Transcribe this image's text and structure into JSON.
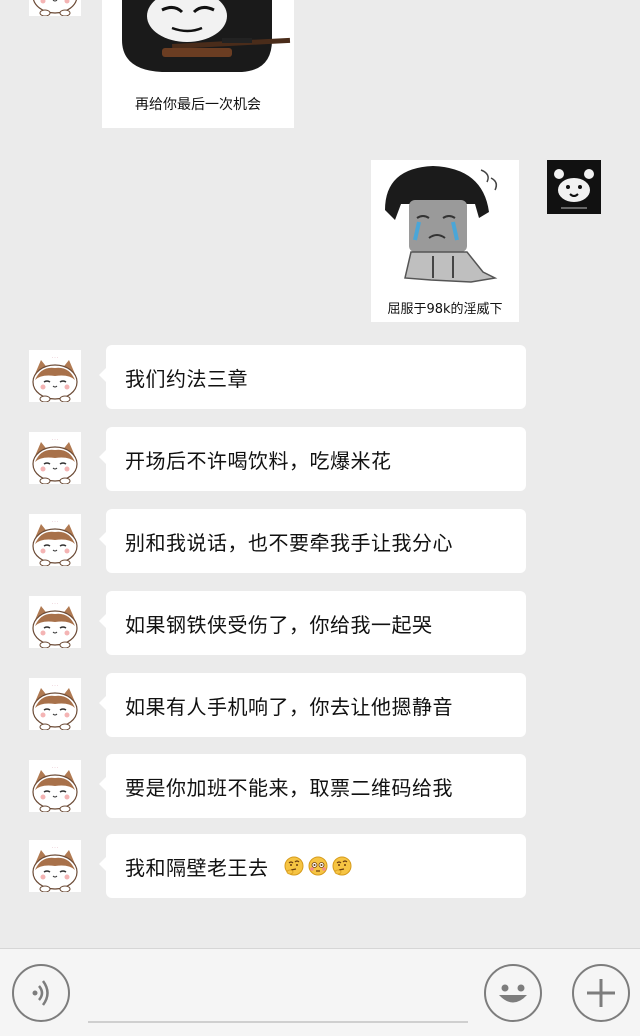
{
  "stickers": {
    "received_caption": "再给你最后一次机会",
    "sent_caption": "屈服于98k的淫威下"
  },
  "messages": [
    {
      "text": "我们约法三章"
    },
    {
      "text": "开场后不许喝饮料，吃爆米花"
    },
    {
      "text": "别和我说话，也不要牵我手让我分心"
    },
    {
      "text": "如果钢铁侠受伤了，你给我一起哭"
    },
    {
      "text": "如果有人手机响了，你去让他摁静音"
    },
    {
      "text": "要是你加班不能来，取票二维码给我"
    },
    {
      "text": "我和隔壁老王去",
      "emojis": [
        "thinking-face-emoji",
        "flushed-face-emoji",
        "thinking-face-emoji"
      ]
    }
  ],
  "input_bar": {
    "icons": [
      "voice-icon",
      "emoji-icon",
      "plus-icon"
    ]
  },
  "colors": {
    "chat_background": "#ebebeb",
    "bubble": "#ffffff",
    "input_bar": "#f5f5f5"
  }
}
